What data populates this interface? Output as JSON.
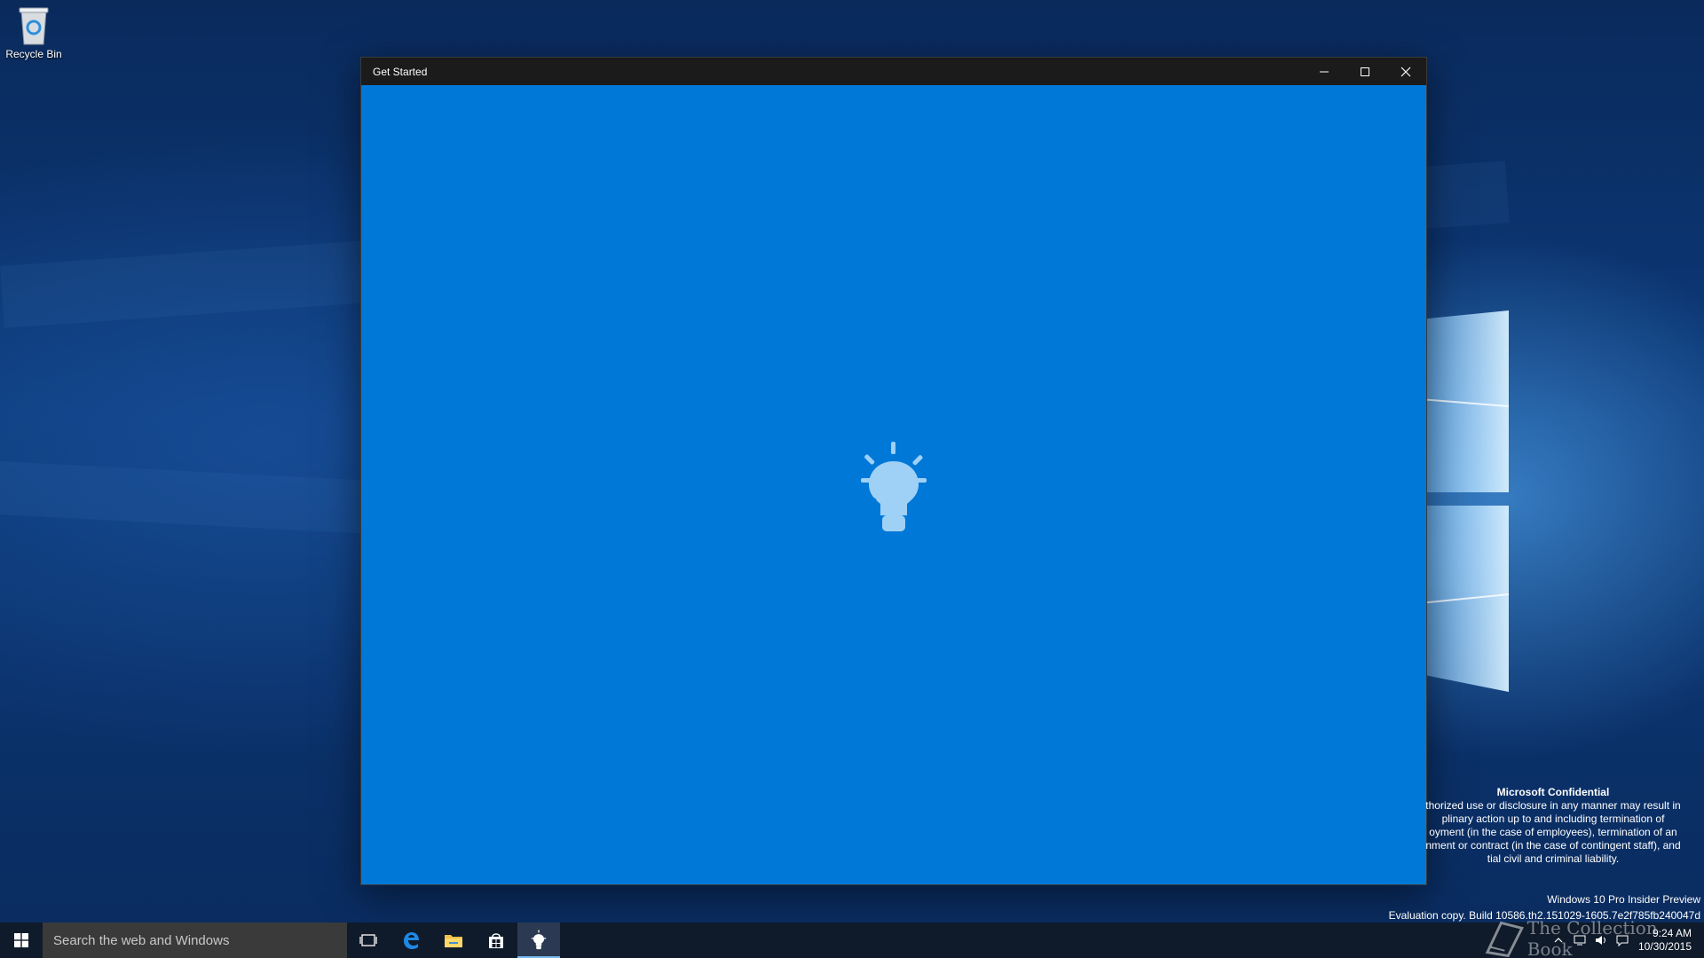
{
  "desktop": {
    "icons": [
      {
        "label": "Recycle Bin",
        "icon": "recycle-bin-icon"
      }
    ]
  },
  "window": {
    "title": "Get Started",
    "controls": [
      "minimize-icon",
      "maximize-icon",
      "close-icon"
    ],
    "content_icon": "lightbulb-icon",
    "colors": {
      "content_bg": "#0078d7",
      "titlebar_bg": "#1b1b1b"
    }
  },
  "confidential": {
    "heading": "Microsoft Confidential",
    "lines": [
      "thorized use or disclosure in any manner may result in",
      "plinary action up to and including termination of",
      "oyment (in the case of employees), termination of an",
      "nment or contract (in the case of contingent staff), and",
      "tial civil and criminal liability."
    ]
  },
  "build": {
    "edition": "Windows 10 Pro Insider Preview",
    "evaluation": "Evaluation copy. Build 10586.th2.151029-1605.7e2f785fb240047d"
  },
  "taskbar": {
    "search_placeholder": "Search the web and Windows",
    "pinned": [
      "task-view-icon",
      "edge-icon",
      "file-explorer-icon",
      "store-icon",
      "get-started-icon"
    ],
    "clock": {
      "time": "9:24 AM",
      "date": "10/30/2015"
    },
    "watermark": "The Collection Book"
  }
}
